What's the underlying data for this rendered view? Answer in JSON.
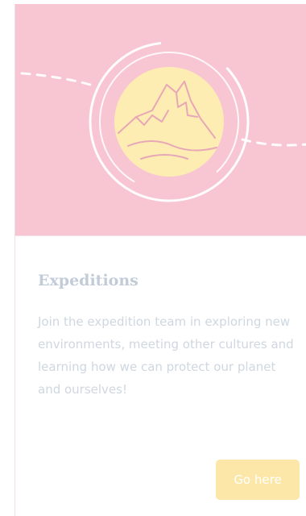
{
  "card": {
    "title": "Expeditions",
    "description": "Join the expedition team in exploring new environments, meeting other cultures and learning how we can protect our planet and ourselves!",
    "button_label": "Go here"
  },
  "colors": {
    "hero_background": "#f7c6d2",
    "emblem_fill": "#fdedb3",
    "mountain_line": "#e8a7b6",
    "button_background": "#fde7a8",
    "title_text": "#c2ccd8",
    "body_text": "#cfd7e0"
  },
  "icons": {
    "hero": "mountain-emblem-icon"
  }
}
